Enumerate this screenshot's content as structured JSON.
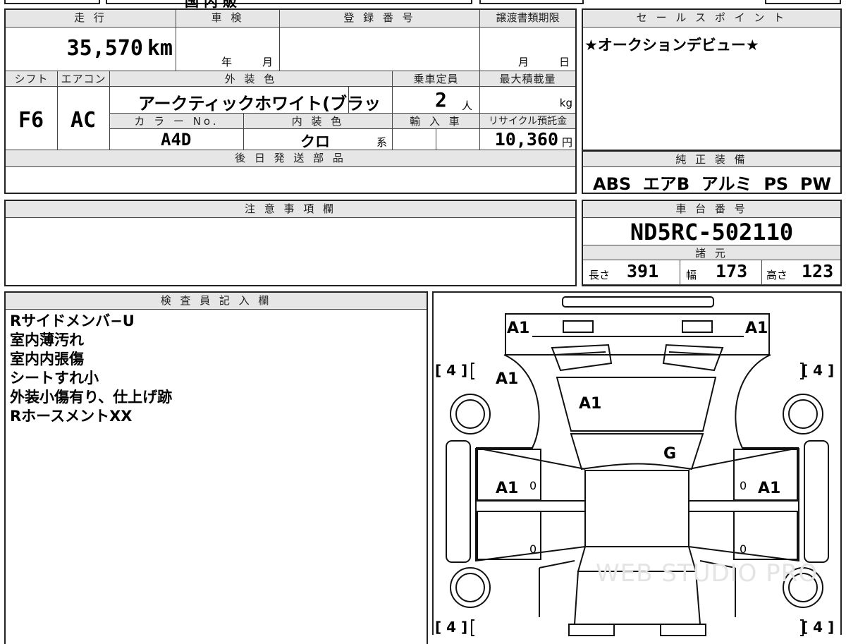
{
  "top_fragment": "国 内 販",
  "vehicle": {
    "headers": {
      "mileage": "走 行",
      "inspection": "車 検",
      "registration_no": "登 録 番 号",
      "transfer_deadline": "譲渡書類期限",
      "shift": "シフト",
      "aircon": "エアコン",
      "exterior_color": "外 装 色",
      "capacity": "乗車定員",
      "max_load": "最大積載量",
      "color_no": "カ ラ ー No.",
      "interior_color": "内 装 色",
      "import": "輸 入 車",
      "recycle_fee": "リサイクル預託金",
      "later_parts": "後 日 発 送 部 品"
    },
    "mileage": "35,570",
    "mileage_unit": "km",
    "inspection_year": "年",
    "inspection_month": "月",
    "transfer_month": "月",
    "transfer_day": "日",
    "shift": "F6",
    "aircon": "AC",
    "exterior_color": "アークティックホワイト(ブラッ",
    "capacity": "2",
    "capacity_unit": "人",
    "max_load_unit": "kg",
    "color_no": "A4D",
    "interior_color": "クロ",
    "interior_suffix": "系",
    "recycle_fee": "10,360",
    "recycle_unit": "円"
  },
  "sales_point": {
    "header": "セ ー ル ス ポ イ ン ト",
    "text": "★オークションデビュー★"
  },
  "equipment": {
    "header": "純 正 装 備",
    "text": "ABS  エアB  アルミ  PS  PW"
  },
  "notes": {
    "header": "注 意 事 項 欄"
  },
  "chassis": {
    "header": "車 台 番 号",
    "number": "ND5RC-502110"
  },
  "specs": {
    "header": "諸 元",
    "length_label": "長さ",
    "length": "391",
    "width_label": "幅",
    "width": "173",
    "height_label": "高さ",
    "height": "123"
  },
  "inspector": {
    "header": "検 査 員 記 入 欄",
    "lines": [
      "Rサイドメンバ−U",
      "室内薄汚れ",
      "室内内張傷",
      "シートすれ小",
      "外装小傷有り、仕上げ跡",
      "RホースメントXX"
    ]
  },
  "diagram": {
    "marks": {
      "front_left": "A1",
      "front_right": "A1",
      "left_fender": "A1",
      "hood": "A1",
      "windshield": "G",
      "left_door": "A1",
      "right_door": "A1",
      "left_door_zero": "0",
      "right_door_zero": "0",
      "left_rear_zero": "0",
      "right_rear_zero": "0"
    },
    "tires": {
      "front_left": "[ 4 ]",
      "front_right": "[ 4 ]",
      "rear_left": "[ 4 ]",
      "rear_right": "[ 4 ]"
    },
    "watermark": "WEB STUDIO PRO"
  }
}
